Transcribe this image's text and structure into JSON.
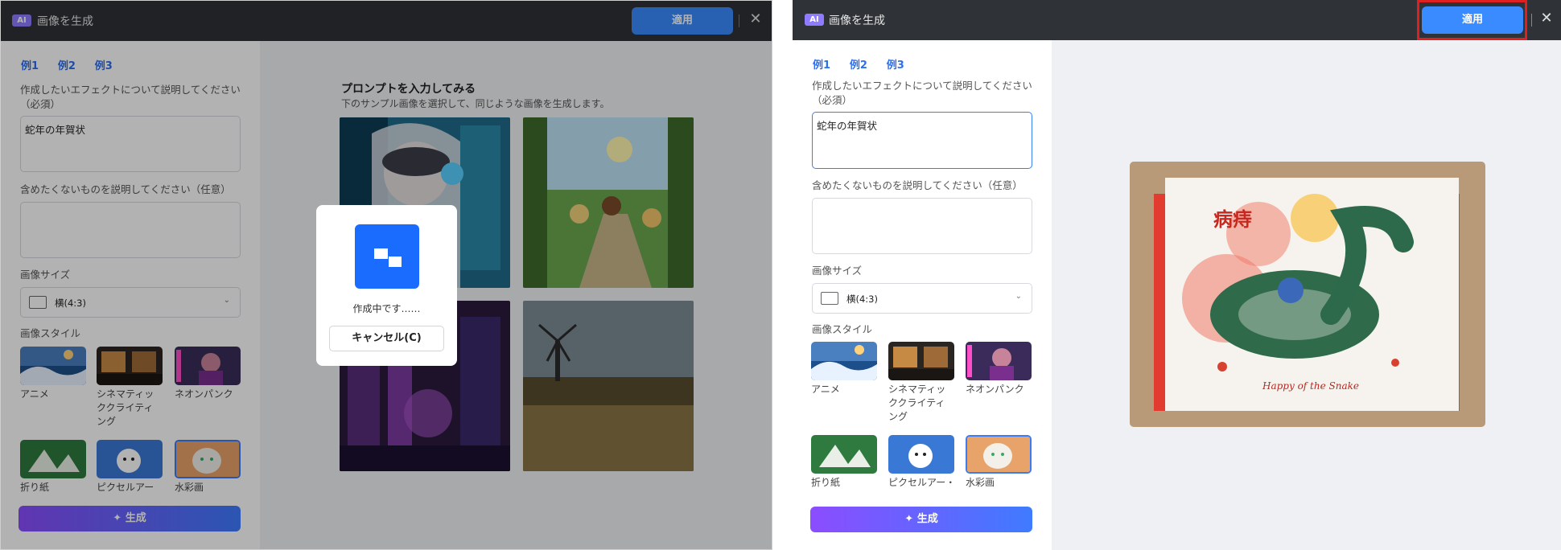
{
  "app": {
    "badge": "AI",
    "title": "画像を生成",
    "apply_label": "適用",
    "close_symbol": "✕"
  },
  "examples": [
    "例1",
    "例2",
    "例3"
  ],
  "form": {
    "effect_label": "作成したいエフェクトについて説明してください（必須）",
    "effect_value": "蛇年の年賀状",
    "negative_label": "含めたくないものを説明してください（任意）",
    "negative_value": "",
    "size_label": "画像サイズ",
    "size_value": "横(4:3)",
    "style_label": "画像スタイル",
    "styles": [
      {
        "label": "アニメ",
        "selected": false
      },
      {
        "label": "シネマティッククライティング",
        "selected": false
      },
      {
        "label": "ネオンパンク",
        "selected": false
      },
      {
        "label": "折り紙",
        "selected": false
      },
      {
        "label": "ピクセルアー",
        "selected": false
      },
      {
        "label": "水彩画",
        "selected": true
      }
    ],
    "styles_right": [
      "アニメ",
      "シネマティッククライティング",
      "ネオンパンク",
      "折り紙",
      "ピクセルアー・",
      "水彩画"
    ],
    "generate_label": "生成"
  },
  "samples": {
    "title": "プロンプトを入力してみる",
    "subtitle": "下のサンプル画像を選択して、同じような画像を生成します。"
  },
  "modal": {
    "status": "作成中です……",
    "cancel_label": "キャンセル(C)"
  },
  "result": {
    "card_text": "Happy of the Snake",
    "card_chars": "病痔"
  },
  "colors": {
    "accent": "#3a8bff",
    "titlebar": "#2f3237",
    "highlight": "#e02020",
    "logo": "#1a6cff"
  },
  "icons": {
    "close": "close-icon",
    "sparkle": "sparkle-icon",
    "chevron": "chevron-down-icon",
    "size": "aspect-ratio-icon"
  }
}
